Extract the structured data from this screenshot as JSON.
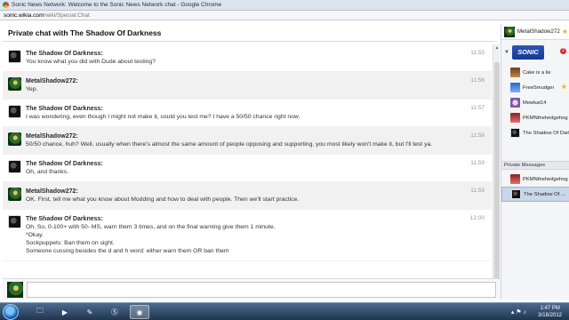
{
  "window": {
    "title": "Sonic News Network: Welcome to the Sonic News Network chat - Google Chrome"
  },
  "address": {
    "host": "sonic.wikia.com",
    "path": "/wiki/Special:Chat"
  },
  "chat": {
    "header": "Private chat with The Shadow Of Darkness",
    "messages": [
      {
        "user": "The Shadow Of Darkness:",
        "avatar": "shadow",
        "time": "11:55",
        "lines": [
          "You know what you did with Dude about testing?"
        ]
      },
      {
        "user": "MetalShadow272:",
        "avatar": "metal",
        "time": "11:56",
        "lines": [
          "Yep."
        ]
      },
      {
        "user": "The Shadow Of Darkness:",
        "avatar": "shadow",
        "time": "11:57",
        "lines": [
          "I was wondering, even though I might not make it, could you test me? I have a 50/50 chance right now."
        ]
      },
      {
        "user": "MetalShadow272:",
        "avatar": "metal",
        "time": "11:58",
        "lines": [
          "50/50 chance, huh? Well, usually when there's almost the same amount of people opposing and supporting, you most likely won't make it, but I'll test ya."
        ]
      },
      {
        "user": "The Shadow Of Darkness:",
        "avatar": "shadow",
        "time": "11:59",
        "lines": [
          "Oh, and thanks."
        ]
      },
      {
        "user": "MetalShadow272:",
        "avatar": "metal",
        "time": "11:59",
        "lines": [
          "OK. First, tell me what you know about Modding and how to deal with people. Then we'll start practice."
        ]
      },
      {
        "user": "The Shadow Of Darkness:",
        "avatar": "shadow",
        "time": "12:00",
        "lines": [
          "Oh. So, 0-100+ with 50- MS, warn them 3 times, and on the final warning give them 1 minute.",
          "*Okay.",
          "Sockpuppets: Ban them on sight.",
          "Someone cussing besides the d and h word: either warn them OR ban them"
        ]
      }
    ],
    "input_placeholder": ""
  },
  "sidebar": {
    "self_user": "MetalShadow272",
    "wiki_logo_text": "SONIC",
    "room_badge": "2",
    "users": [
      {
        "name": "Cake is a lie",
        "avatar": "c-cake",
        "star": false
      },
      {
        "name": "FreeSmudger",
        "avatar": "c-free",
        "star": true
      },
      {
        "name": "Mewkat14",
        "avatar": "c-mew",
        "star": false
      },
      {
        "name": "PKMNthehedgehog",
        "avatar": "c-pkm",
        "star": false
      },
      {
        "name": "The Shadow Of Darkness",
        "avatar": "av-shadow",
        "star": false
      }
    ],
    "pm_header": "Private Messages",
    "private_messages": [
      {
        "name": "PKMNthehedgehog",
        "avatar": "c-pkm",
        "selected": false
      },
      {
        "name": "The Shadow Of ...",
        "avatar": "av-shadow",
        "selected": true
      }
    ]
  },
  "taskbar": {
    "time": "1:47 PM",
    "date": "3/18/2012",
    "apps": [
      "windows-explorer-icon",
      "media-player-icon",
      "pen-icon",
      "skype-icon",
      "chrome-icon"
    ]
  }
}
